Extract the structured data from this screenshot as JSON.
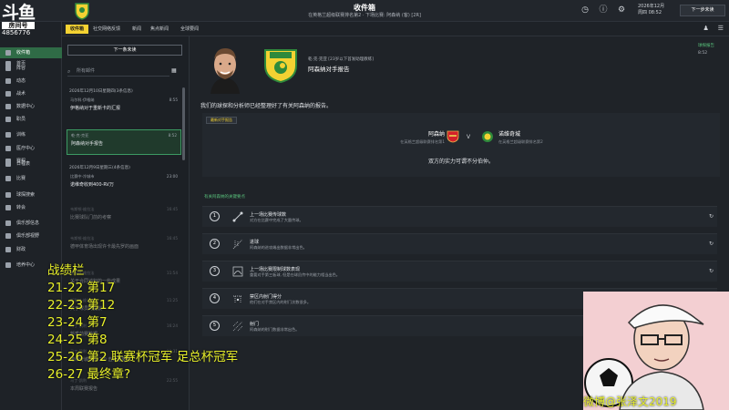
{
  "top": {
    "title": "收件箱",
    "subtitle": "在英格兰超级联赛排名第2 · 下场比赛: 阿森纳 (客) [2R]",
    "date": "2026年12月",
    "date_sub": "周四 08:52",
    "continue": "下一步未读"
  },
  "tabs": [
    {
      "label": "收件箱"
    },
    {
      "label": "社交网络反馈"
    },
    {
      "label": "新闻"
    },
    {
      "label": "焦点新闻"
    },
    {
      "label": "全球要闻"
    }
  ],
  "nav": [
    {
      "label": "首页"
    },
    {
      "label": "收件箱"
    },
    {
      "label": "阵容"
    },
    {
      "label": "动态"
    },
    {
      "label": "战术"
    },
    {
      "label": "数据中心"
    },
    {
      "label": "职员"
    },
    {
      "label": "训练"
    },
    {
      "label": "医疗中心"
    },
    {
      "label": "赛程"
    },
    {
      "label": "日程表"
    },
    {
      "label": "比赛"
    },
    {
      "label": "球探搜索"
    },
    {
      "label": "转会"
    },
    {
      "label": "俱乐部信息"
    },
    {
      "label": "俱乐部视野"
    },
    {
      "label": "财政"
    },
    {
      "label": "培养中心"
    }
  ],
  "overlay": {
    "logo": "斗鱼",
    "room_label": "房间号",
    "room_number": "4856776",
    "record_title": "战绩栏",
    "records": [
      "21-22 第17",
      "22-23 第12",
      "23-24 第7",
      "24-25 第8",
      "25-26 第2 联赛杯冠军 足总杯冠军",
      "26-27 最终章?"
    ],
    "weibo": "微博@张泽文2019"
  },
  "inbox": {
    "next_button": "下一条未读",
    "search_placeholder": "所有邮件",
    "groups": [
      {
        "label": "2026年12月10日星期四(3条信息)"
      },
      {
        "label": "2026年12月9日星期三(4条信息)"
      }
    ],
    "messages": [
      {
        "from": "马尔科·伊格纳",
        "subject": "伊格纳对于重新卡的汇报",
        "time": "8:55"
      },
      {
        "from": "乾·克·克亚",
        "subject": "阿森纳对手报告",
        "time": "8:52"
      },
      {
        "from": "比赛中·冷城市",
        "subject": "诺维奇收到400-RV万",
        "time": "23:00"
      },
      {
        "from": "韦斯顿·维拉法",
        "subject": "比赛球队门前的考察",
        "time": "16:45"
      },
      {
        "from": "韦斯顿·维拉法",
        "subject": "德甲体育场出现许卡最先罗的画面",
        "time": "16:45"
      },
      {
        "from": "斯科特·维拉法",
        "subject": "关于合同谈判的一些成果",
        "time": "11:54"
      },
      {
        "from": "斯科特·维拉法",
        "subject": "关于球员的提议",
        "time": "11:25"
      },
      {
        "from": "马丁·凯利",
        "subject": "新季前赛数据",
        "time": "16:24"
      },
      {
        "from": "马丁·凯利",
        "subject": "诺维奇城队在 2-0 击败重要胜",
        "time": "23:31"
      },
      {
        "from": "马丁·凯利",
        "subject": "本周联赛报告",
        "time": "22:55"
      }
    ]
  },
  "message": {
    "from": "乾·克·克亚 [23岁以下首发助理教练]",
    "subject": "阿森纳对手报告",
    "label": "球探报告",
    "time": "8:52",
    "intro": "我们的球探和分析师已经整理好了有关阿森纳的报告。",
    "badge": "最新对手报告",
    "team_a": {
      "name": "阿森纳",
      "position": "在英格兰超级联赛排名第1"
    },
    "team_b": {
      "name": "诺维奇城",
      "position": "在英格兰超级联赛排名第2"
    },
    "vs": "V",
    "summary": "双方的实力可谓不分伯仲。",
    "section_title": "有关阿森纳的关键要点",
    "points": [
      {
        "num": "1",
        "title": "上一场比赛传球数",
        "desc": "对方在比赛中完成了大量传球。"
      },
      {
        "num": "2",
        "title": "进球",
        "desc": "阿森纳的进攻端出数据非常出色。"
      },
      {
        "num": "3",
        "title": "上一场比赛限制球数表现",
        "desc": "重要对手第三板球, 但是在球员传中的能力相当出色。"
      },
      {
        "num": "4",
        "title": "禁区内射门得分",
        "desc": "他们在对手禁区内的射门次数很多。"
      },
      {
        "num": "5",
        "title": "射门",
        "desc": "阿森纳的射门数据非常出色。"
      }
    ]
  },
  "colors": {
    "accent": "#f4d232",
    "active_nav": "#2f6b46",
    "green_text": "#59c17c",
    "overlay_text": "#e8f02a"
  }
}
